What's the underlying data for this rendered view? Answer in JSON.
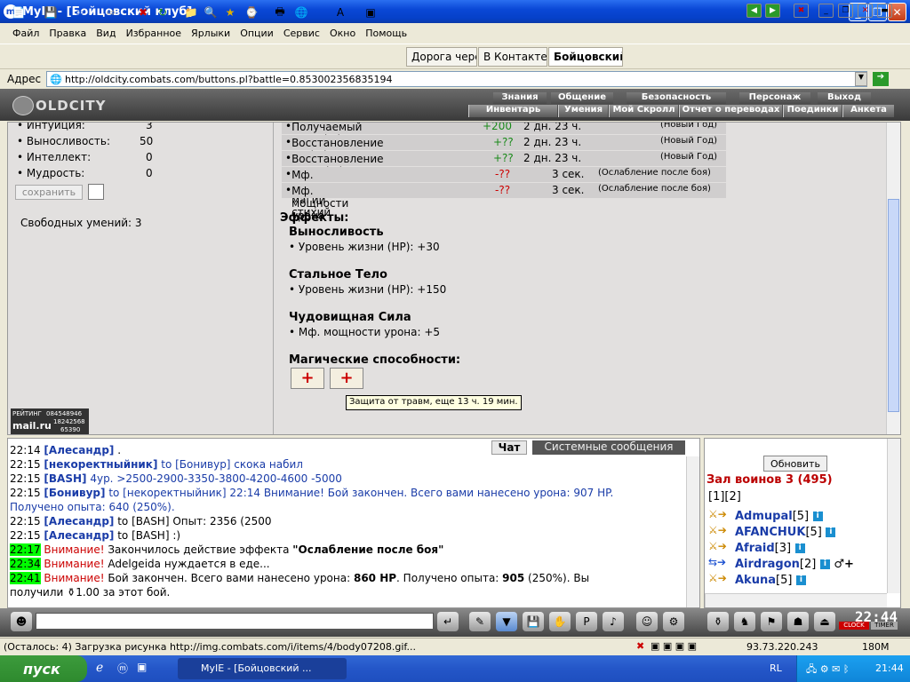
{
  "window": {
    "title": "MyIE - [Бойцовский клуб]",
    "app_icon": "myie-icon"
  },
  "menu": [
    "Файл",
    "Правка",
    "Вид",
    "Избранное",
    "Ярлыки",
    "Опции",
    "Сервис",
    "Окно",
    "Помощь"
  ],
  "tabs": [
    "Дорога чере",
    "В Контакте",
    "Бойцовский"
  ],
  "address": {
    "label": "Адрес",
    "url": "http://oldcity.combats.com/buttons.pl?battle=0.853002356835194"
  },
  "game_header": {
    "logo": "OLDCITY",
    "top_nav": [
      "Знания",
      "Общение",
      "Безопасность",
      "Персонаж",
      "Выход"
    ],
    "bottom_nav": [
      "Инвентарь",
      "Умения",
      "Мой Скролл",
      "Отчет о переводах",
      "Поединки",
      "Анкета"
    ]
  },
  "stats": [
    {
      "name": "Интуиция:",
      "value": "3"
    },
    {
      "name": "Выносливость:",
      "value": "50"
    },
    {
      "name": "Интеллект:",
      "value": "0"
    },
    {
      "name": "Мудрость:",
      "value": "0"
    }
  ],
  "save_button": "сохранить",
  "free_skills": "Свободных умений: 3",
  "buffs": [
    {
      "name": "Получаемый опыт (%)",
      "value": "+200",
      "time": "2 дн. 23 ч.",
      "source": "(Новый Год)"
    },
    {
      "name": "Восстановление HP (%)",
      "value": "+??",
      "time": "2 дн. 23 ч.",
      "source": "(Новый Год)"
    },
    {
      "name": "Восстановление маны (%)",
      "value": "+??",
      "time": "2 дн. 23 ч.",
      "source": "(Новый Год)"
    },
    {
      "name": "Мф. мощности магии стихий",
      "value": "-??",
      "time": "3 сек.",
      "source": "(Ослабление после боя)"
    },
    {
      "name": "Мф. мощности урона",
      "value": "-??",
      "time": "3 сек.",
      "source": "(Ослабление после боя)"
    }
  ],
  "effects": {
    "heading": "Эффекты:",
    "items": [
      {
        "name": "Выносливость",
        "detail": "• Уровень жизни (HP): +30"
      },
      {
        "name": "Стальное Тело",
        "detail": "• Уровень жизни (HP): +150"
      },
      {
        "name": "Чудовищная Сила",
        "detail": "• Мф. мощности урона: +5"
      }
    ],
    "magic_heading": "Магические способности:",
    "tooltip": "Защита от травм, еще 13 ч. 19 мин."
  },
  "counter": {
    "label": "РЕЙТИНГ",
    "brand": "mail.ru",
    "n1": "084548946",
    "n2": "18242568",
    "n3": "65390"
  },
  "chat_tabs": [
    "Чат",
    "Системные сообщения"
  ],
  "chat": [
    {
      "time": "22:14",
      "nick": "[Алесандр]",
      "text": " ."
    },
    {
      "time": "22:15",
      "nick": "[некоректныйник]",
      "text": " to [Бонивур] скока набил"
    },
    {
      "time": "22:15",
      "nick": "[BASH]",
      "text": " 4ур. >2500-2900-3350-3800-4200-4600 -5000"
    },
    {
      "time": "22:15",
      "nick": "[Бонивур]",
      "text": " to [некоректныйник] 22:14 Внимание! Бой закончен. Всего вами нанесено урона: 907 HP."
    },
    {
      "time": "",
      "nick": "",
      "text": "Получено опыта: 640 (250%)."
    },
    {
      "time": "22:15",
      "nick": "[Алесандр]",
      "text": " to [BASH] Опыт: 2356 (2500"
    },
    {
      "time": "22:15",
      "nick": "[Алесандр]",
      "text": " to [BASH] :)"
    }
  ],
  "system": [
    {
      "time": "22:17",
      "warn": "Внимание!",
      "text": " Закончилось действие эффекта ",
      "bold": "\"Ослабление после боя\""
    },
    {
      "time": "22:34",
      "warn": "Внимание!",
      "text": " Adelgeida нуждается в еде...",
      "bold": ""
    },
    {
      "time": "22:41",
      "warn": "Внимание!",
      "text": " Бой закончен. Всего вами нанесено урона: ",
      "bold": "860 HP"
    }
  ],
  "system_extra": {
    "t1": ". Получено опыта: ",
    "b1": "905",
    "t2": " (250%). Вы",
    "line2": "получили ",
    "money": "1.00",
    "line2b": " за этот бой."
  },
  "room": {
    "refresh": "Обновить",
    "title": "Зал воинов 3 (495)",
    "pages": "[1][2]",
    "players": [
      {
        "name": "Admupal",
        "level": "[5]"
      },
      {
        "name": "AFANCHUK",
        "level": "[5]"
      },
      {
        "name": "Afraid",
        "level": "[3]"
      },
      {
        "name": "Airdragon",
        "level": "[2]"
      },
      {
        "name": "Akuna",
        "level": "[5]"
      }
    ]
  },
  "clock": {
    "time": "22:44",
    "label1": "CLOCK",
    "label2": "TIMER"
  },
  "status_bar": {
    "text": "(Осталось: 4) Загрузка рисунка http://img.combats.com/i/items/4/body07208.gif...",
    "ip": "93.73.220.243",
    "mem": "180M"
  },
  "taskbar": {
    "start": "пуск",
    "task": "MyIE - [Бойцовский ...",
    "lang": "RL",
    "time": "21:44"
  }
}
